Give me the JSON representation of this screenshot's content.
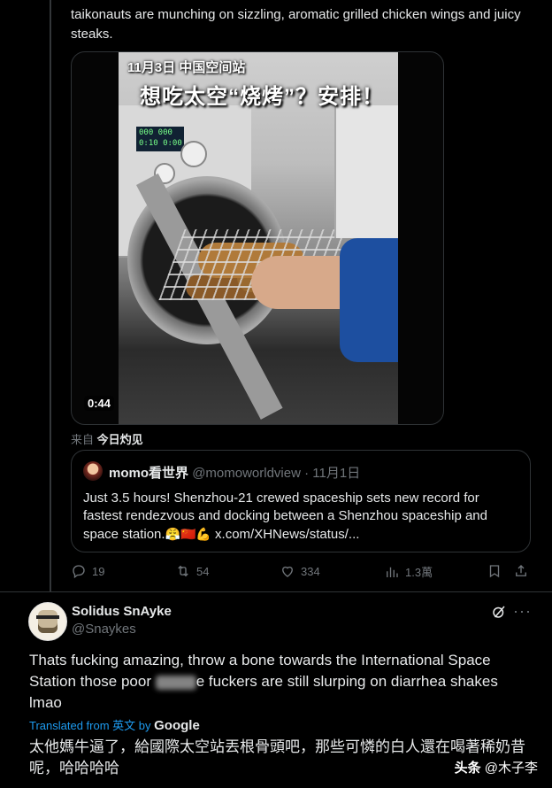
{
  "top_text": "taikonauts are munching on sizzling, aromatic grilled chicken wings and juicy steaks.",
  "media": {
    "caption_date": "11月3日 中国空间站",
    "caption_title": "想吃太空“烧烤”？安排！",
    "display_text": "000 000\n0:10 0:00",
    "duration": "0:44"
  },
  "source": {
    "prefix": "来自",
    "name": "今日灼见"
  },
  "quoted": {
    "name": "momo看世界",
    "handle": "@momoworldview",
    "sep": "·",
    "date": "11月1日",
    "text": "Just 3.5 hours! Shenzhou-21 crewed spaceship sets new record for fastest rendezvous and docking between a Shenzhou spaceship and space station.",
    "emojis": "😤🇨🇳💪",
    "link": "x.com/XHNews/status/..."
  },
  "actions": {
    "replies": "19",
    "reposts": "54",
    "likes": "334",
    "views": "1.3萬"
  },
  "reply": {
    "name": "Solidus SnAyke",
    "handle": "@Snaykes",
    "text_before": "Thats fucking amazing, throw a bone towards the International Space Station those poor ",
    "text_after": "e fuckers are still slurping on diarrhea shakes lmao",
    "translated_label": "Translated from 英文 by",
    "translator": "Google",
    "zh_text": "太他媽牛逼了，給國際太空站丟根骨頭吧，那些可憐的白人還在喝著稀奶昔呢，哈哈哈哈"
  },
  "watermark": {
    "brand": "头条",
    "user": "@木子李"
  },
  "colors": {
    "background": "#000000",
    "text": "#e7e9ea",
    "muted": "#71767b",
    "link": "#1d9bf0",
    "border": "#2f3336"
  }
}
